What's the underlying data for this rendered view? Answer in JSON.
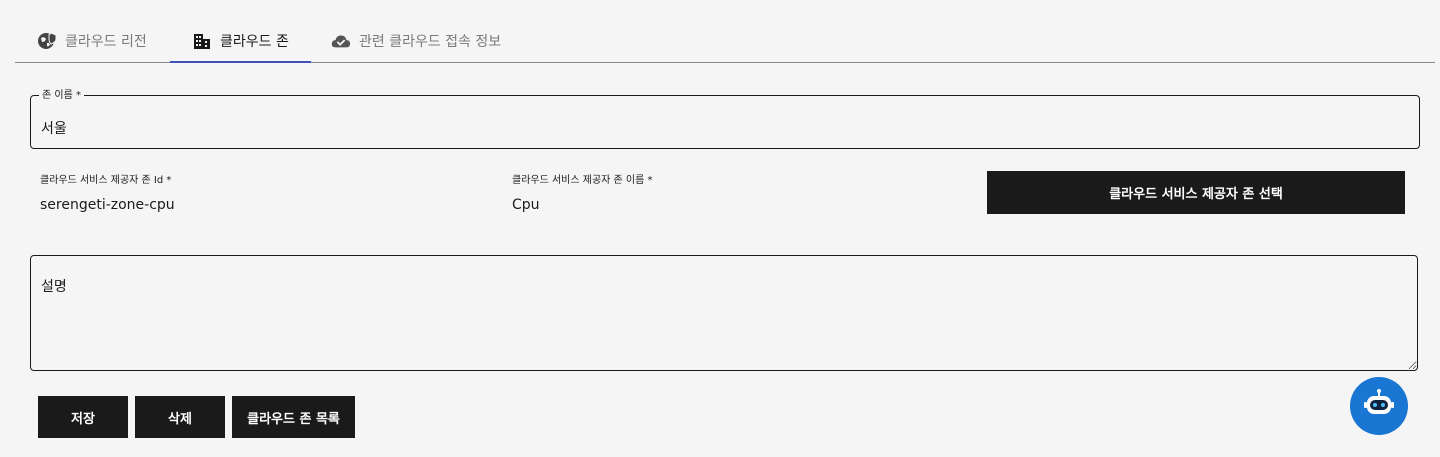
{
  "tabs": [
    {
      "label": "클라우드 리전",
      "icon": "globe-shield-icon",
      "active": false
    },
    {
      "label": "클라우드 존",
      "icon": "building-icon",
      "active": true
    },
    {
      "label": "관련 클라우드 접속 정보",
      "icon": "cloud-check-icon",
      "active": false
    }
  ],
  "form": {
    "zone_name": {
      "label": "존 이름 *",
      "value": "서울"
    },
    "provider_zone_id": {
      "label": "클라우드 서비스 제공자 존 Id *",
      "value": "serengeti-zone-cpu"
    },
    "provider_zone_name": {
      "label": "클라우드 서비스 제공자 존 이름 *",
      "value": "Cpu"
    },
    "select_button_label": "클라우드 서비스 제공자 존 선택",
    "description": {
      "placeholder": "설명",
      "value": ""
    }
  },
  "actions": {
    "save_label": "저장",
    "delete_label": "삭제",
    "list_label": "클라우드 존 목록"
  },
  "colors": {
    "background": "#f5f5f5",
    "button": "#1a1a1a",
    "tab_indicator": "#3f51b5",
    "fab": "#1976d2"
  },
  "chatbot": {
    "icon": "robot-icon"
  }
}
